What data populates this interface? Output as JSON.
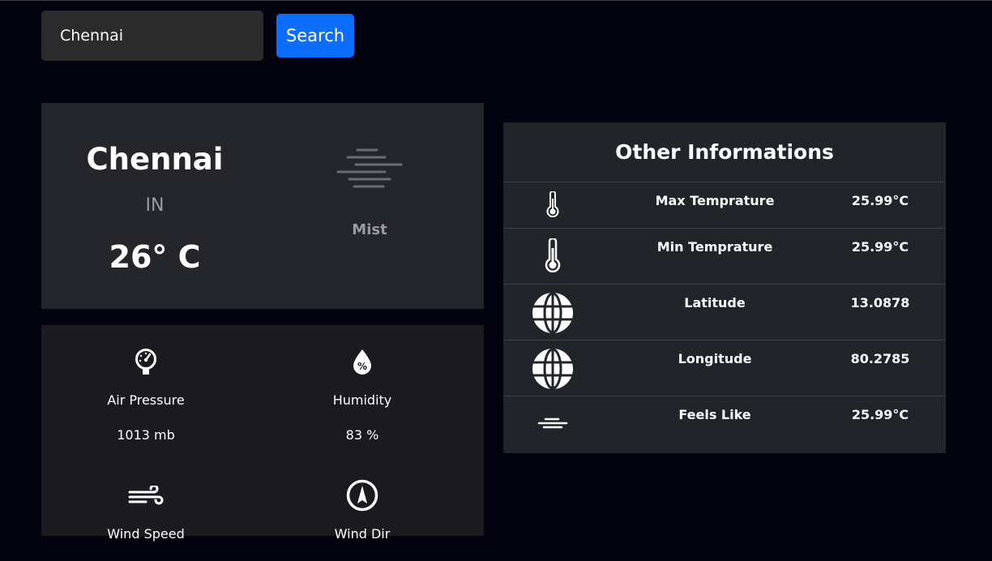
{
  "search": {
    "value": "Chennai",
    "button_label": "Search"
  },
  "weather": {
    "city": "Chennai",
    "country": "IN",
    "temperature": "26° C",
    "condition": "Mist",
    "condition_icon": "mist-icon"
  },
  "details": [
    {
      "label": "Air Pressure",
      "value": "1013 mb",
      "icon": "gauge-icon"
    },
    {
      "label": "Humidity",
      "value": "83 %",
      "icon": "humidity-icon"
    },
    {
      "label": "Wind Speed",
      "value": "",
      "icon": "wind-icon"
    },
    {
      "label": "Wind Dir",
      "value": "",
      "icon": "compass-icon"
    }
  ],
  "other_info": {
    "title": "Other Informations",
    "rows": [
      {
        "name": "Max Temprature",
        "value": "25.99°C",
        "icon": "thermometer-icon"
      },
      {
        "name": "Min Temprature",
        "value": "25.99°C",
        "icon": "thermometer-icon"
      },
      {
        "name": "Latitude",
        "value": "13.0878",
        "icon": "globe-icon"
      },
      {
        "name": "Longitude",
        "value": "80.2785",
        "icon": "globe-icon"
      },
      {
        "name": "Feels Like",
        "value": "25.99°C",
        "icon": "mist-icon"
      }
    ]
  },
  "colors": {
    "background": "#03030f",
    "accent": "#0d6efd",
    "card": "#25252c",
    "table": "#212429"
  }
}
